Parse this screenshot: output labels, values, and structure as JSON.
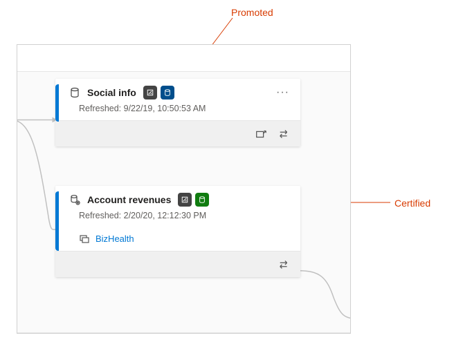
{
  "annotations": {
    "promoted": "Promoted",
    "certified": "Certified"
  },
  "cards": [
    {
      "title": "Social info",
      "refreshed": "Refreshed: 9/22/19, 10:50:53 AM",
      "badges": {
        "sensitivity": true,
        "promoted": true,
        "certified": false
      },
      "link": null
    },
    {
      "title": "Account revenues",
      "refreshed": "Refreshed: 2/20/20, 12:12:30 PM",
      "badges": {
        "sensitivity": true,
        "promoted": false,
        "certified": true
      },
      "link": "BizHealth"
    }
  ],
  "colors": {
    "accent": "#0078d4",
    "annotation": "#d83b01",
    "promoted": "#004e8c",
    "certified": "#107c10",
    "sensitivity": "#444444"
  }
}
